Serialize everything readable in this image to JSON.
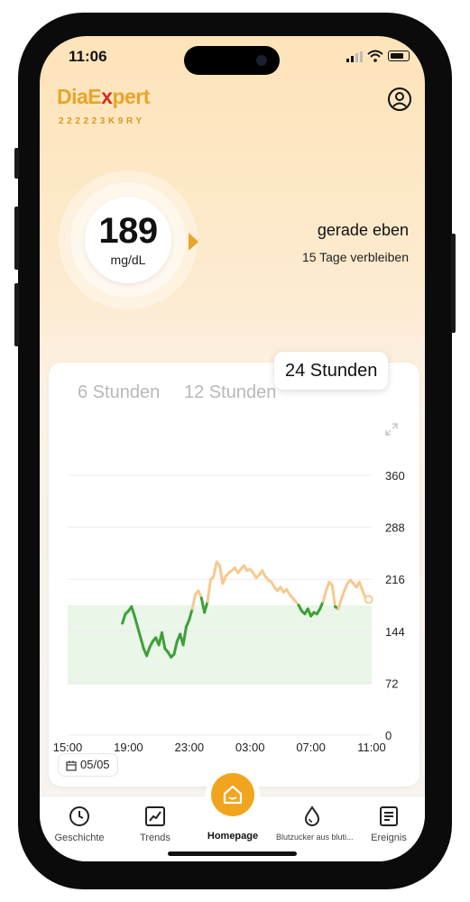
{
  "status": {
    "time": "11:06"
  },
  "app": {
    "brand_prefix": "DiaE",
    "brand_x": "x",
    "brand_suffix": "pert",
    "serial": "222223K9RY"
  },
  "reading": {
    "value": "189",
    "unit": "mg/dL",
    "updated": "gerade eben",
    "remaining": "15 Tage verbleiben",
    "trend": "steady"
  },
  "chart_tabs": [
    {
      "label": "6 Stunden",
      "active": false
    },
    {
      "label": "12 Stunden",
      "active": false
    },
    {
      "label": "24 Stunden",
      "active": true
    }
  ],
  "date_button": {
    "label": "05/05"
  },
  "colors": {
    "accent": "#f1a51e",
    "in_range": "#3e9f3a",
    "high": "#f5c98f",
    "target_band": "#eaf6e8"
  },
  "chart_data": {
    "type": "line",
    "y_ticks": [
      360,
      288,
      216,
      144,
      72,
      0
    ],
    "x_ticks": [
      "15:00",
      "19:00",
      "23:00",
      "03:00",
      "07:00",
      "11:00"
    ],
    "ylim": [
      0,
      360
    ],
    "x_range_hours": [
      15,
      35
    ],
    "target_range": [
      70,
      180
    ],
    "high_threshold": 180,
    "series": [
      {
        "x": [
          18.6,
          18.8,
          19.0,
          19.2,
          19.4,
          19.6,
          19.8,
          20.0,
          20.2,
          20.4,
          20.6,
          20.8,
          21.0,
          21.2,
          21.4,
          21.6,
          21.8,
          22.0,
          22.2,
          22.4,
          22.6,
          22.8,
          23.0,
          23.2,
          23.4,
          23.6,
          23.8,
          24.0,
          24.2,
          24.4,
          24.6,
          24.8,
          25.0,
          25.2,
          25.4,
          25.6,
          25.8,
          26.0,
          26.2,
          26.4,
          26.6,
          26.8,
          27.0,
          27.2,
          27.4,
          27.6,
          27.8,
          28.0,
          28.2,
          28.4,
          28.6,
          28.8,
          29.0,
          29.2,
          29.4,
          29.6,
          29.8,
          30.0,
          30.2,
          30.4,
          30.6,
          30.8,
          31.0,
          31.2,
          31.4,
          31.6,
          31.8,
          32.0,
          32.2,
          32.4,
          32.6,
          32.8,
          33.0,
          33.2,
          33.4,
          33.6,
          33.8,
          34.0,
          34.2,
          34.4,
          34.6,
          34.8
        ],
        "values": [
          155,
          168,
          172,
          178,
          165,
          150,
          135,
          120,
          110,
          122,
          130,
          135,
          125,
          142,
          120,
          115,
          108,
          112,
          130,
          140,
          125,
          150,
          160,
          175,
          195,
          200,
          190,
          170,
          185,
          215,
          220,
          240,
          235,
          210,
          220,
          225,
          228,
          232,
          225,
          230,
          235,
          228,
          230,
          225,
          218,
          222,
          228,
          220,
          215,
          212,
          205,
          200,
          205,
          198,
          202,
          195,
          190,
          185,
          180,
          172,
          168,
          175,
          165,
          170,
          168,
          175,
          185,
          200,
          212,
          208,
          178,
          175,
          188,
          200,
          210,
          215,
          210,
          205,
          212,
          200,
          190,
          188
        ]
      }
    ]
  },
  "nav": {
    "history": "Geschichte",
    "trends": "Trends",
    "home": "Homepage",
    "fingerstick": "Blutzucker aus bluti...",
    "events": "Ereignis"
  }
}
